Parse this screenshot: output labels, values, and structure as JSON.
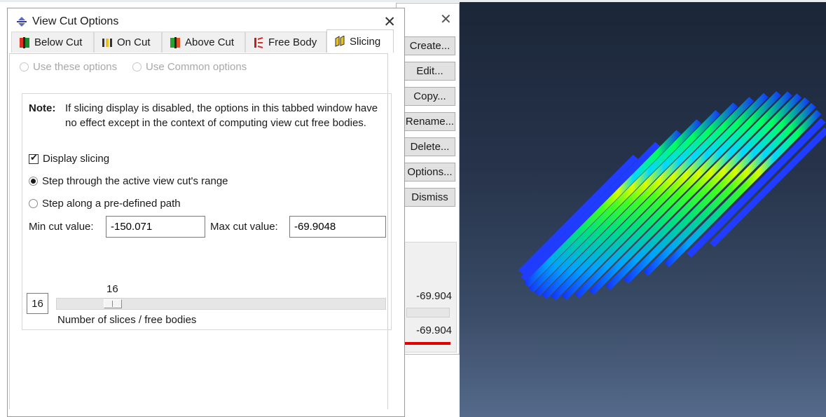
{
  "dialog": {
    "title": "View Cut Options",
    "close_glyph": "✕",
    "tabs": [
      {
        "label": "Below Cut",
        "icon": "below-cut-icon"
      },
      {
        "label": "On Cut",
        "icon": "on-cut-icon"
      },
      {
        "label": "Above Cut",
        "icon": "above-cut-icon"
      },
      {
        "label": "Free Body",
        "icon": "free-body-icon"
      },
      {
        "label": "Slicing",
        "icon": "slicing-icon",
        "active": true
      }
    ],
    "scope": {
      "use_these": "Use these options",
      "use_common": "Use Common options"
    },
    "note": {
      "label": "Note:",
      "text": "If slicing display is disabled, the options in this tabbed window have no effect except in the context of computing view cut free bodies."
    },
    "display_slicing": {
      "label": "Display slicing",
      "checked": true
    },
    "step_active": {
      "label": "Step through the active view cut's range",
      "selected": true
    },
    "step_path": {
      "label": "Step along a pre-defined path",
      "selected": false
    },
    "min_cut": {
      "label": "Min cut value:",
      "value": "-150.071"
    },
    "max_cut": {
      "label": "Max cut value:",
      "value": "-69.9048"
    },
    "slices": {
      "value": "16",
      "slider_label": "16",
      "caption": "Number of slices / free bodies"
    }
  },
  "manager": {
    "close_glyph": "✕",
    "buttons": [
      "Create...",
      "Edit...",
      "Copy...",
      "Rename...",
      "Delete...",
      "Options...",
      "Dismiss"
    ],
    "value_top": "-69.904",
    "value_bottom": "-69.904"
  },
  "colors": {
    "viewport_top": "#1b2638",
    "viewport_bottom": "#55698a",
    "slice_blue": "#1f3cff",
    "accent_red": "#e00000"
  }
}
